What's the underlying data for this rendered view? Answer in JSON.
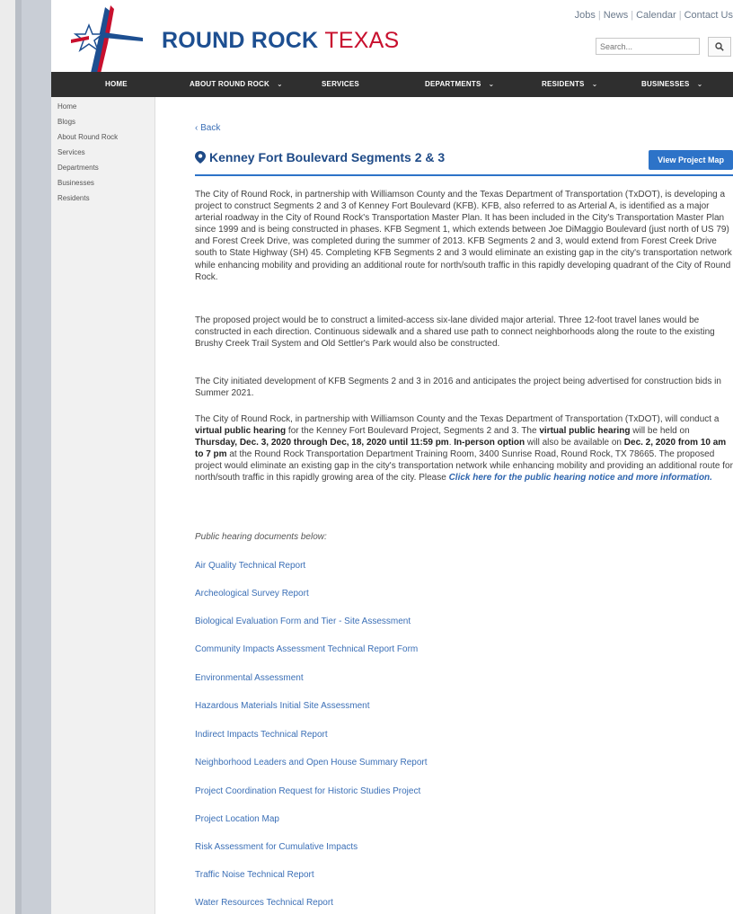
{
  "header": {
    "brand_primary": "ROUND ROCK",
    "brand_secondary": "TEXAS",
    "top_links": [
      "Jobs",
      "News",
      "Calendar",
      "Contact Us"
    ],
    "search_placeholder": "Search..."
  },
  "nav": [
    {
      "label": "HOME",
      "chevron": false
    },
    {
      "label": "ABOUT ROUND ROCK",
      "chevron": true
    },
    {
      "label": "SERVICES",
      "chevron": false
    },
    {
      "label": "DEPARTMENTS",
      "chevron": true
    },
    {
      "label": "RESIDENTS",
      "chevron": true
    },
    {
      "label": "BUSINESSES",
      "chevron": true
    }
  ],
  "sidebar": [
    "Home",
    "Blogs",
    "About Round Rock",
    "Services",
    "Departments",
    "Businesses",
    "Residents"
  ],
  "page": {
    "back_label": "Back",
    "title": "Kenney Fort Boulevard Segments 2 & 3",
    "map_button": "View Project Map",
    "paragraph1": "The City of Round Rock, in partnership with Williamson County and the Texas Department of Transportation (TxDOT), is developing a project to construct Segments 2 and 3 of Kenney Fort Boulevard (KFB). KFB, also referred to as Arterial A, is identified as a major arterial roadway in the City of Round Rock's Transportation Master Plan. It has been included in the City's Transportation Master Plan since 1999 and is being constructed in phases. KFB Segment 1, which extends between Joe DiMaggio Boulevard (just north of US 79) and Forest Creek Drive, was completed during the summer of 2013. KFB Segments 2 and 3, would extend from Forest Creek Drive south to State Highway (SH) 45. Completing KFB Segments 2 and 3 would eliminate an existing gap in the city's transportation network while enhancing mobility and providing an additional route for north/south traffic in this rapidly developing quadrant of the City of Round Rock.",
    "paragraph2": "The proposed project would be to construct a limited-access six-lane divided major arterial. Three 12-foot travel lanes would be constructed in each direction. Continuous sidewalk and a shared use path to connect neighborhoods along the route to the existing Brushy Creek Trail System and Old Settler's Park would also be constructed.",
    "paragraph3": "The City initiated development of KFB Segments 2 and 3 in 2016 and anticipates the project being advertised for construction bids in Summer 2021.",
    "paragraph4": {
      "t1": "The City of Round Rock, in partnership with Williamson County and the Texas Department of Transportation (TxDOT), will conduct a ",
      "b1": "virtual public hearing",
      "t2": " for the Kenney Fort Boulevard Project, Segments 2 and 3. The ",
      "b2": "virtual public hearing",
      "t3": " will be held on ",
      "b3": "Thursday, Dec. 3, 2020 through Dec, 18, 2020 until 11:59 pm",
      "t4": ". ",
      "b4": "In-person option",
      "t5": " will also be available on ",
      "b5": "Dec. 2, 2020 from 10 am to 7 pm",
      "t6": " at the Round Rock Transportation Department Training Room, 3400 Sunrise Road, Round Rock, TX 78665. The proposed project would eliminate an existing gap in the city's transportation network while enhancing mobility and providing an additional route for north/south traffic in this rapidly growing area of the city. Please ",
      "link": "Click here for the public hearing notice and more information."
    },
    "docs_heading": "Public hearing documents below:",
    "documents": [
      "Air Quality Technical Report",
      "Archeological Survey Report",
      "Biological Evaluation Form and Tier - Site Assessment",
      "Community Impacts Assessment Technical Report Form",
      "Environmental Assessment",
      "Hazardous Materials Initial Site Assessment",
      "Indirect Impacts Technical Report",
      "Neighborhood Leaders and Open House Summary Report",
      "Project Coordination Request for Historic Studies Project",
      "Project Location Map",
      "Risk Assessment for Cumulative Impacts",
      "Traffic Noise Technical Report",
      "Water Resources Technical Report"
    ]
  },
  "colors": {
    "brand_blue": "#1d4f91",
    "brand_red": "#c8102e",
    "link_blue": "#3b6fb6",
    "nav_bg": "#2f2f2f",
    "button_blue": "#2d73c8"
  }
}
